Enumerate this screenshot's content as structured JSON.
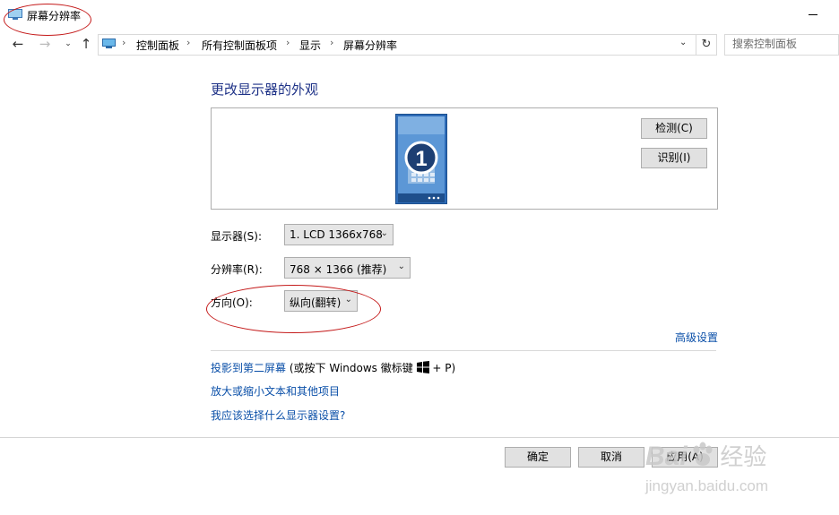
{
  "window": {
    "title": "屏幕分辨率"
  },
  "address_bar": {
    "breadcrumbs": [
      "控制面板",
      "所有控制面板项",
      "显示",
      "屏幕分辨率"
    ],
    "search_placeholder": "搜索控制面板"
  },
  "main": {
    "heading": "更改显示器的外观",
    "monitor_number": "1",
    "detect_label": "检测(C)",
    "identify_label": "识别(I)",
    "display_label": "显示器(S):",
    "display_value": "1. LCD 1366x768",
    "resolution_label": "分辨率(R):",
    "resolution_value": "768 × 1366 (推荐)",
    "orientation_label": "方向(O):",
    "orientation_value": "纵向(翻转)",
    "advanced_link": "高级设置",
    "project_link": "投影到第二屏幕",
    "project_hint_before": "(或按下 Windows 徽标键",
    "project_hint_after": "+ P)",
    "text_size_link": "放大或缩小文本和其他项目",
    "help_link": "我应该选择什么显示器设置?"
  },
  "footer": {
    "ok_label": "确定",
    "cancel_label": "取消",
    "apply_label": "应用(A)"
  },
  "watermark": {
    "brand": "Bai",
    "brand_suffix": "经验",
    "url": "jingyan.baidu.com"
  },
  "colors": {
    "heading": "#1e3287",
    "link": "#0a4fa8",
    "annotation": "#c41a1a",
    "monitor": "#2e6cb8"
  }
}
